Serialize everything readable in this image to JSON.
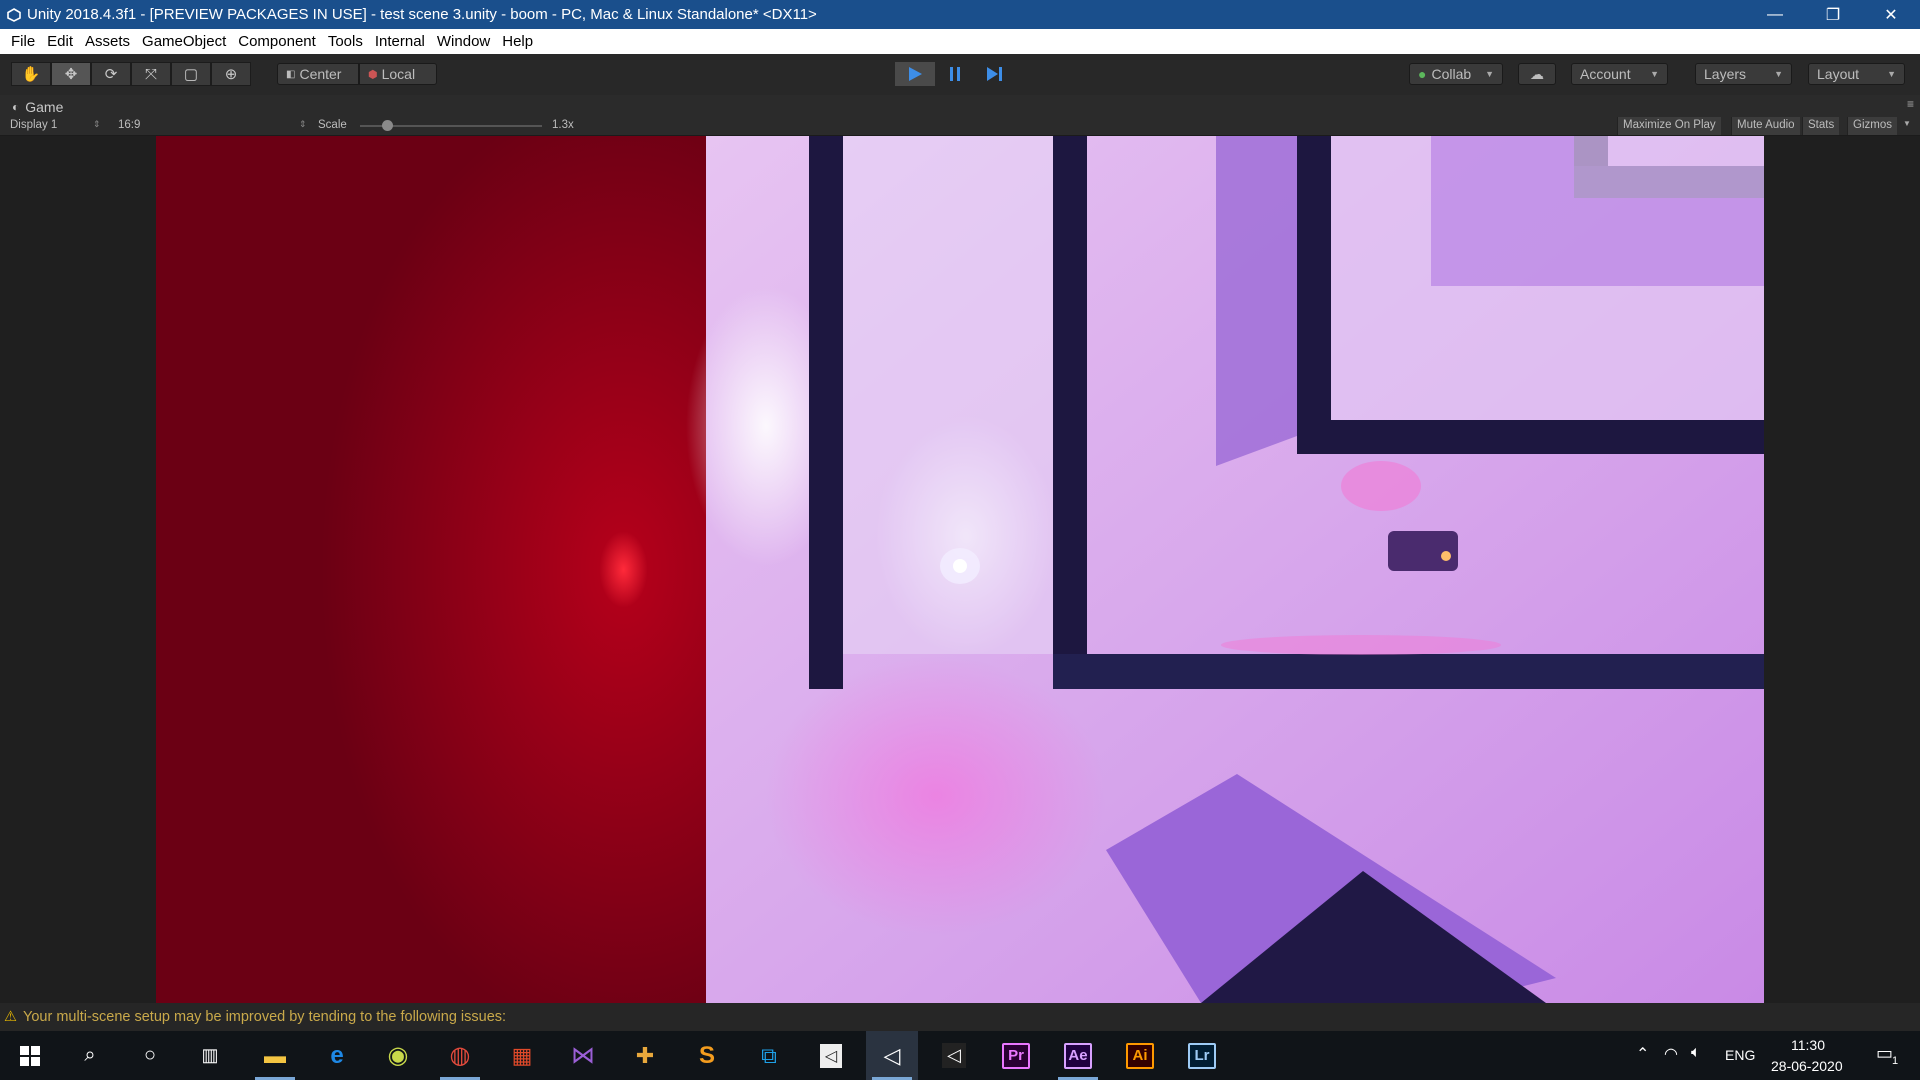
{
  "window": {
    "title": "Unity 2018.4.3f1 - [PREVIEW PACKAGES IN USE] - test scene 3.unity - boom - PC, Mac & Linux Standalone* <DX11>",
    "minimize": "—",
    "restore": "❐",
    "close": "✕"
  },
  "menu": [
    "File",
    "Edit",
    "Assets",
    "GameObject",
    "Component",
    "Tools",
    "Internal",
    "Window",
    "Help"
  ],
  "toolbar": {
    "pivot": "Center",
    "space": "Local",
    "collab": "Collab",
    "account": "Account",
    "layers": "Layers",
    "layout": "Layout"
  },
  "game": {
    "tab": "Game",
    "display": "Display 1",
    "aspect": "16:9",
    "scale_label": "Scale",
    "scale_value": "1.3x",
    "maximize": "Maximize On Play",
    "mute": "Mute Audio",
    "stats": "Stats",
    "gizmos": "Gizmos"
  },
  "status": {
    "message": "Your multi-scene setup may be improved by tending to the following issues:"
  },
  "tray": {
    "lang": "ENG",
    "time": "11:30",
    "date": "28-06-2020",
    "notifications": "1"
  },
  "colors": {
    "titlebar": "#1a4f8c",
    "play_blue": "#3d8ee8",
    "warning": "#c9a94a"
  }
}
